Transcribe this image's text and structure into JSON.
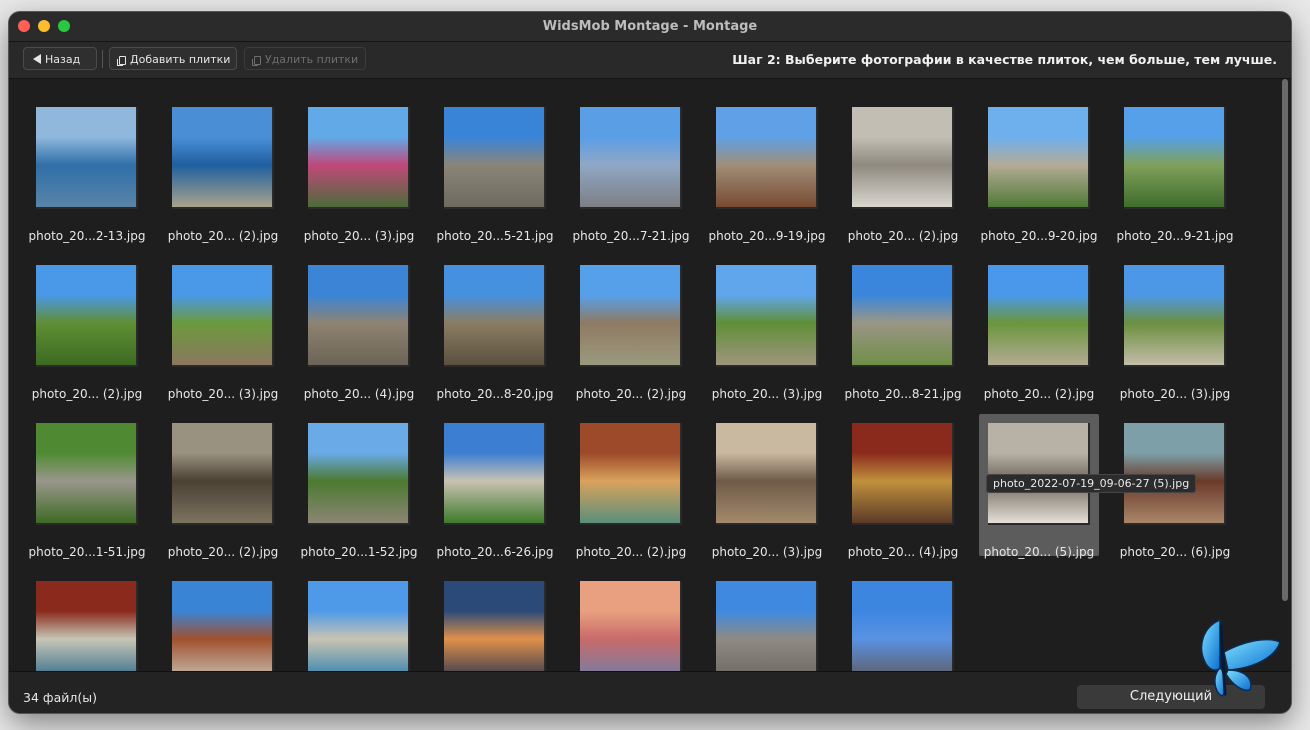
{
  "window": {
    "title": "WidsMob Montage - Montage"
  },
  "toolbar": {
    "back_label": "Назад",
    "add_label": "Добавить плитки",
    "remove_label": "Удалить плитки",
    "step_text": "Шаг 2: Выберите фотографии в качестве плиток, чем больше, тем лучше."
  },
  "tiles": [
    {
      "label": "photo_20...2-13.jpg",
      "colors": [
        "#8fb8dc",
        "#2f6fa8",
        "#5a84a8"
      ]
    },
    {
      "label": "photo_20... (2).jpg",
      "colors": [
        "#4a8fd6",
        "#1f5fa0",
        "#a9a38c"
      ]
    },
    {
      "label": "photo_20... (3).jpg",
      "colors": [
        "#62a9e8",
        "#c0497a",
        "#4d6b3a"
      ]
    },
    {
      "label": "photo_20...5-21.jpg",
      "colors": [
        "#3a84d8",
        "#8a8578",
        "#6d6a5f"
      ]
    },
    {
      "label": "photo_20...7-21.jpg",
      "colors": [
        "#5a9ee6",
        "#8fa7c5",
        "#7e7f83"
      ]
    },
    {
      "label": "photo_20...9-19.jpg",
      "colors": [
        "#5fa0e6",
        "#a08f78",
        "#7a4a32"
      ]
    },
    {
      "label": "photo_20... (2).jpg",
      "colors": [
        "#c2beb4",
        "#8f8a80",
        "#d9d6cf"
      ]
    },
    {
      "label": "photo_20...9-20.jpg",
      "colors": [
        "#6eb0ee",
        "#b4ab96",
        "#4f7a36"
      ]
    },
    {
      "label": "photo_20...9-21.jpg",
      "colors": [
        "#55a0e8",
        "#7fa05a",
        "#3f6d2d"
      ]
    },
    {
      "label": "photo_20... (2).jpg",
      "colors": [
        "#4a98e8",
        "#5f8f34",
        "#3c6a22"
      ]
    },
    {
      "label": "photo_20... (3).jpg",
      "colors": [
        "#4a98e8",
        "#6a9a3c",
        "#8c7760"
      ]
    },
    {
      "label": "photo_20... (4).jpg",
      "colors": [
        "#3b84d6",
        "#8e8372",
        "#6c6456"
      ]
    },
    {
      "label": "photo_20...8-20.jpg",
      "colors": [
        "#4690e0",
        "#8b7d63",
        "#5b5040"
      ]
    },
    {
      "label": "photo_20... (2).jpg",
      "colors": [
        "#56a0ea",
        "#8e7a62",
        "#9b9a7e"
      ]
    },
    {
      "label": "photo_20... (3).jpg",
      "colors": [
        "#60a6ec",
        "#5f8f37",
        "#9f957e"
      ]
    },
    {
      "label": "photo_20...8-21.jpg",
      "colors": [
        "#3a86dc",
        "#9a9684",
        "#6f8f48"
      ]
    },
    {
      "label": "photo_20... (2).jpg",
      "colors": [
        "#4a98ec",
        "#6a963c",
        "#b3ab94"
      ]
    },
    {
      "label": "photo_20... (3).jpg",
      "colors": [
        "#4d98e6",
        "#6b8f40",
        "#c4bca8"
      ]
    },
    {
      "label": "photo_20...1-51.jpg",
      "colors": [
        "#4f8a32",
        "#9a978c",
        "#3d6a24"
      ]
    },
    {
      "label": "photo_20... (2).jpg",
      "colors": [
        "#9a9280",
        "#4a4034",
        "#7c735f"
      ]
    },
    {
      "label": "photo_20...1-52.jpg",
      "colors": [
        "#6aaae6",
        "#4c7a30",
        "#8c8574"
      ]
    },
    {
      "label": "photo_20...6-26.jpg",
      "colors": [
        "#3c7fd2",
        "#c9c2b2",
        "#3e7a2c"
      ]
    },
    {
      "label": "photo_20... (2).jpg",
      "colors": [
        "#9c4a2a",
        "#d9a25c",
        "#5a8f7a"
      ]
    },
    {
      "label": "photo_20... (3).jpg",
      "colors": [
        "#c9b9a0",
        "#6f5a48",
        "#a38a6c"
      ]
    },
    {
      "label": "photo_20... (4).jpg",
      "colors": [
        "#8a2a1c",
        "#c0913c",
        "#5b3a28"
      ]
    },
    {
      "label": "photo_20... (5).jpg",
      "colors": [
        "#b8b2a6",
        "#6d655a",
        "#e4e0d8"
      ],
      "selected": true
    },
    {
      "label": "photo_20... (6).jpg",
      "colors": [
        "#7da0a8",
        "#6a3a2a",
        "#a9866a"
      ]
    },
    {
      "label": "",
      "colors": [
        "#8a2a1c",
        "#c7c6b6",
        "#2f6a8a"
      ]
    },
    {
      "label": "",
      "colors": [
        "#3a84d6",
        "#a0512e",
        "#c8c2b4"
      ]
    },
    {
      "label": "",
      "colors": [
        "#4f9ae8",
        "#c9c3b2",
        "#2a7fb0"
      ]
    },
    {
      "label": "",
      "colors": [
        "#2c4a78",
        "#e0904a",
        "#2c3550"
      ]
    },
    {
      "label": "",
      "colors": [
        "#e9a080",
        "#c86a6a",
        "#6f7fa8"
      ]
    },
    {
      "label": "",
      "colors": [
        "#3f8ae0",
        "#8f8a82",
        "#6b6862"
      ]
    },
    {
      "label": "",
      "colors": [
        "#3d86e0",
        "#5a92e2",
        "#5e5a5c"
      ]
    }
  ],
  "tooltip": {
    "text": "photo_2022-07-19_09-06-27 (5).jpg"
  },
  "footer": {
    "file_count": "34 файл(ы)",
    "next_label": "Следующий"
  }
}
